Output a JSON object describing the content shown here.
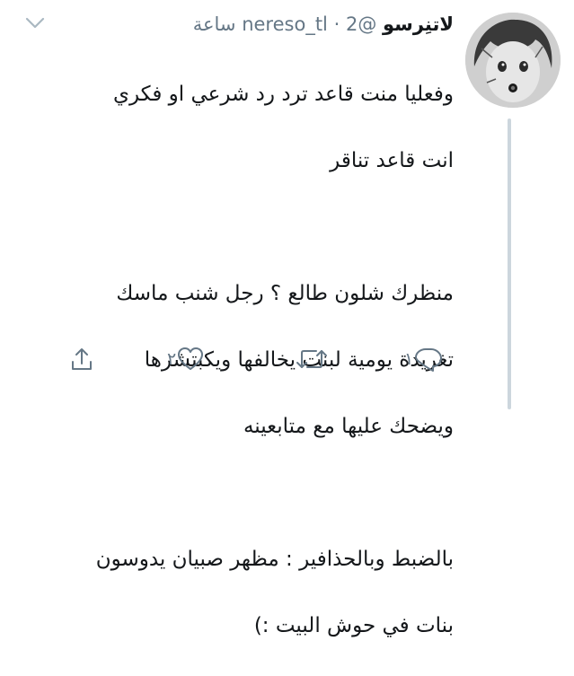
{
  "tweet": {
    "author_name": "لاتنِرسو",
    "handle": "@nereso_tl",
    "separator": "·",
    "time": "2 ساعة",
    "lines": [
      "وفعليا منت قاعد ترد رد شرعي او فكري",
      "انت قاعد تناقر",
      "",
      "منظرك شلون طالع ؟ رجل شنب ماسك",
      "تغريدة يومية لبنت يخالفها ويكبتشرها",
      "ويضحك عليها مع متابعينه",
      "",
      "بالضبط وبالحذافير :  مظهر صبيان يدوسون",
      "بنات في حوش البيت :)"
    ]
  },
  "actions": {
    "reply_count": "١",
    "retweet_count": "",
    "like_count": "٢"
  },
  "icons": {
    "menu": "chevron-down-icon",
    "reply": "reply-icon",
    "retweet": "retweet-icon",
    "like": "heart-icon",
    "share": "share-icon"
  },
  "colors": {
    "text": "#14171a",
    "secondary": "#657786",
    "thread_line": "#ccd6dd"
  }
}
